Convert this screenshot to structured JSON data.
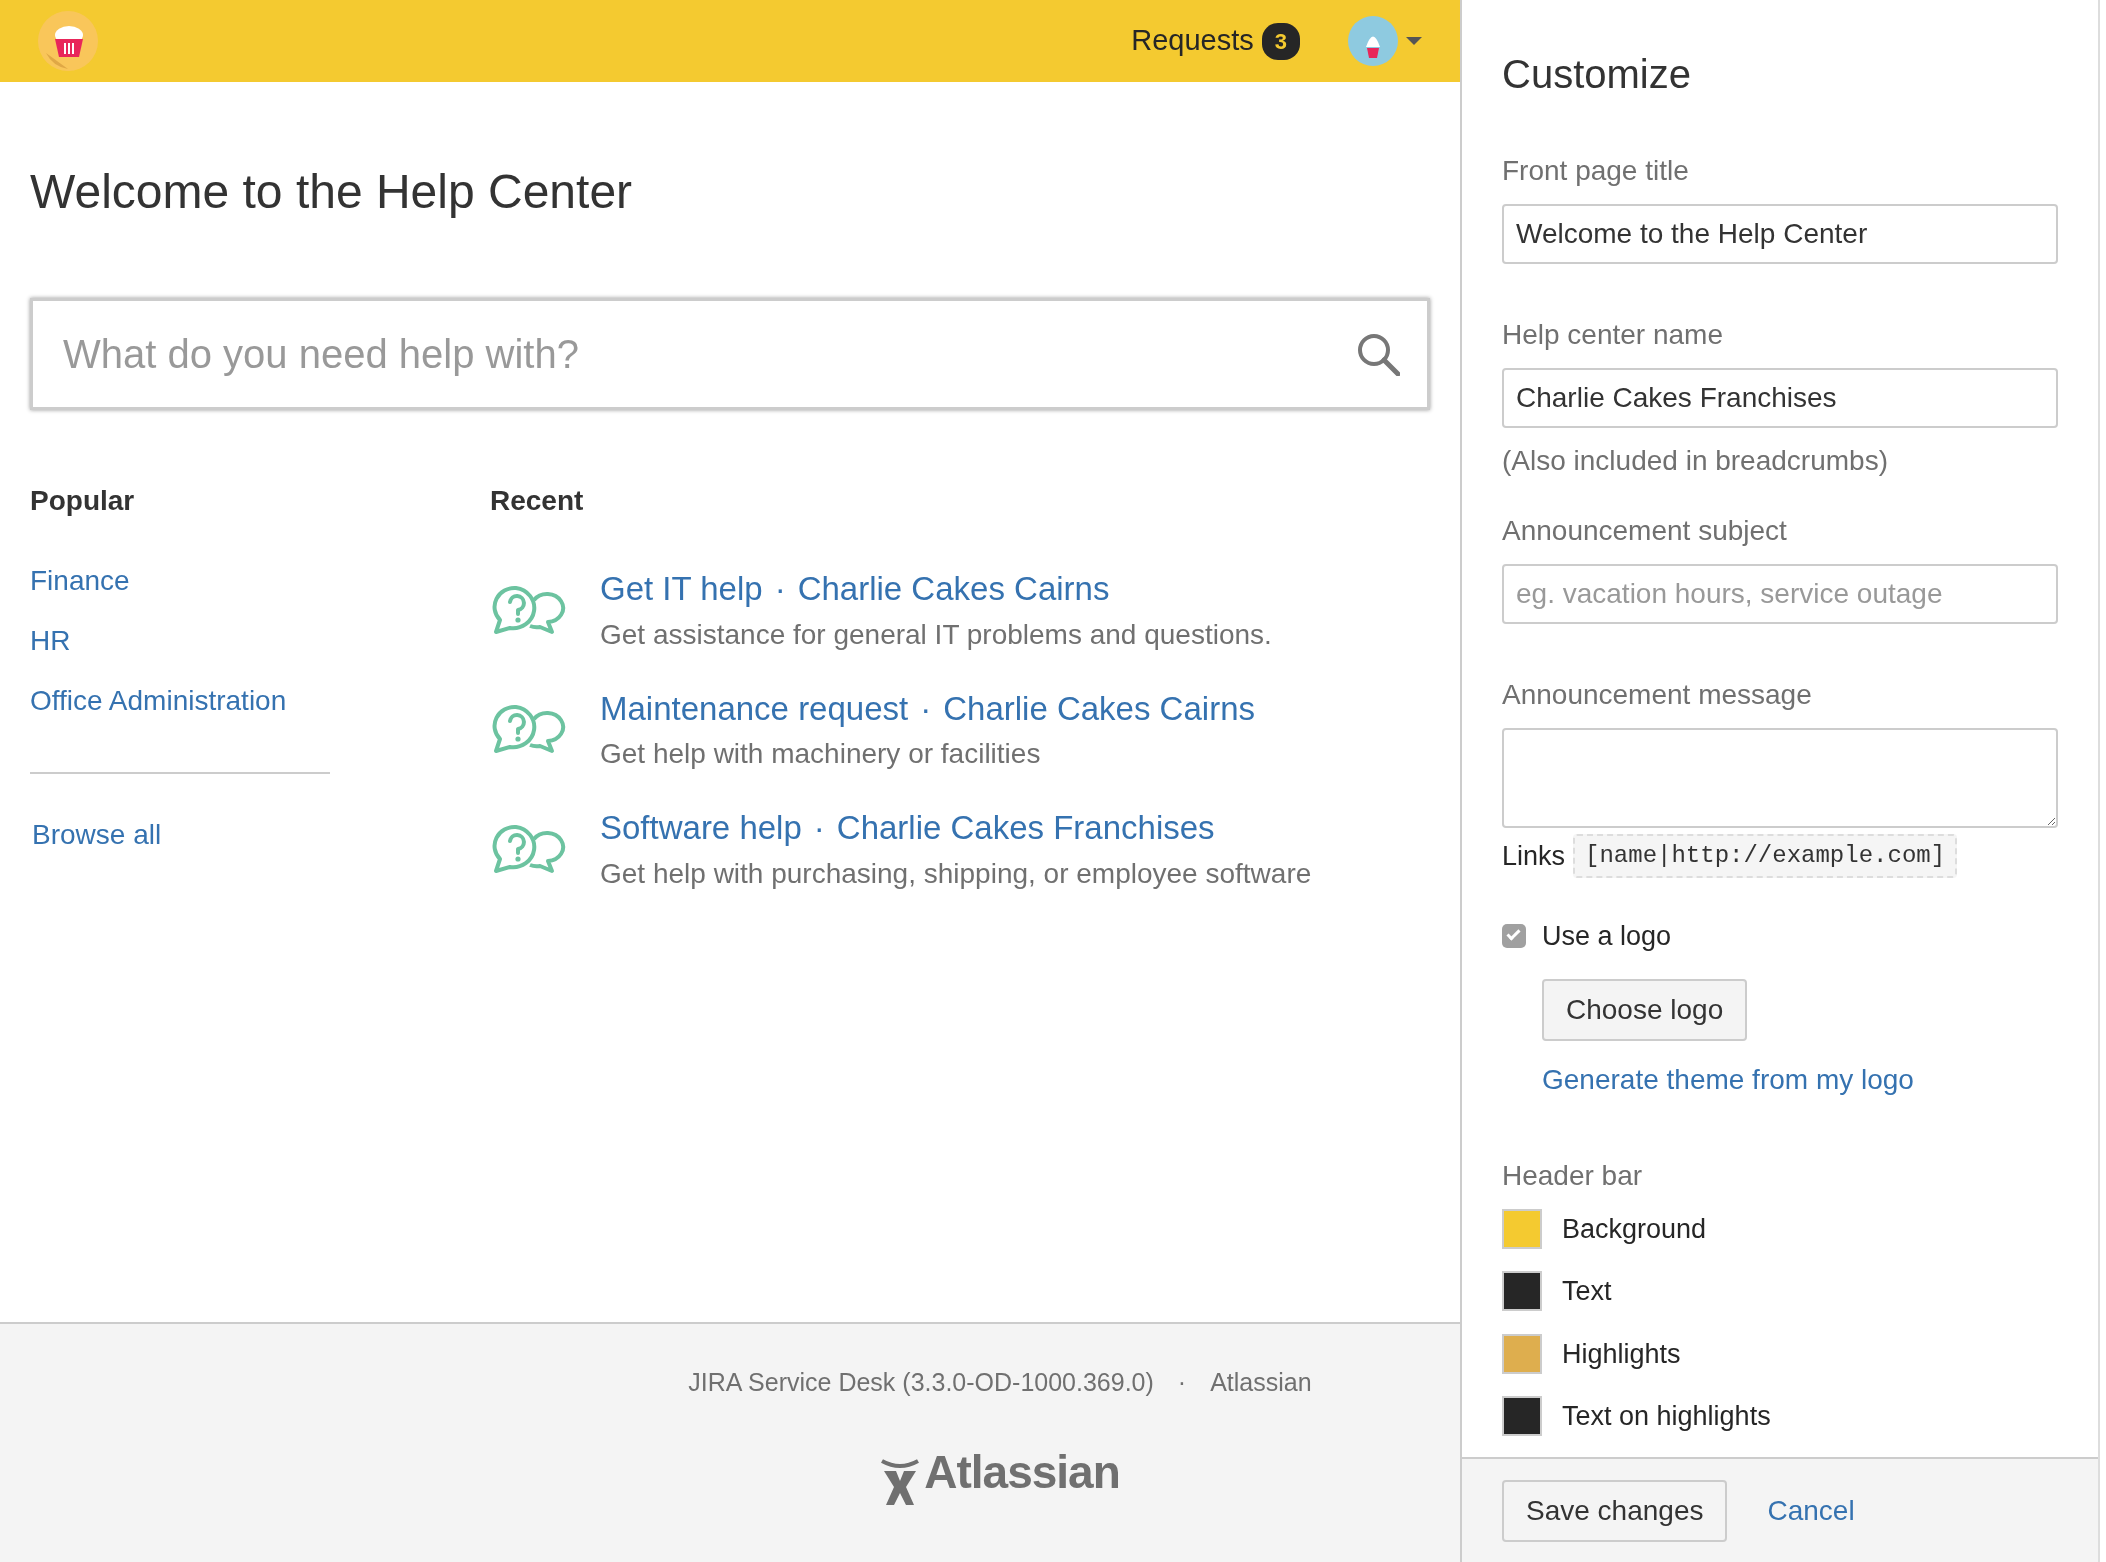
{
  "header": {
    "requests_label": "Requests",
    "requests_count": "3"
  },
  "main": {
    "title": "Welcome to the Help Center",
    "search_placeholder": "What do you need help with?"
  },
  "popular": {
    "heading": "Popular",
    "items": [
      "Finance",
      "HR",
      "Office Administration"
    ],
    "browse_all": "Browse all"
  },
  "recent": {
    "heading": "Recent",
    "items": [
      {
        "name": "Get IT help",
        "separator": "·",
        "project": "Charlie Cakes Cairns",
        "description": "Get assistance for general IT problems and questions."
      },
      {
        "name": "Maintenance request",
        "separator": "·",
        "project": "Charlie Cakes Cairns",
        "description": "Get help with machinery or facilities"
      },
      {
        "name": "Software help",
        "separator": "·",
        "project": "Charlie Cakes Franchises",
        "description": "Get help with purchasing, shipping, or employee software"
      }
    ]
  },
  "footer": {
    "version": "JIRA Service Desk (3.3.0-OD-1000.369.0)",
    "separator": "·",
    "company": "Atlassian",
    "logo_text": "Atlassian"
  },
  "customize": {
    "title": "Customize",
    "fields": [
      {
        "kind": "input",
        "label": "Front page title",
        "value": "Welcome to the Help Center"
      },
      {
        "kind": "input",
        "label": "Help center name",
        "value": "Charlie Cakes Franchises",
        "hint": "(Also included in breadcrumbs)"
      },
      {
        "kind": "input",
        "label": "Announcement subject",
        "placeholder": "eg. vacation hours, service outage"
      },
      {
        "kind": "textarea",
        "label": "Announcement message"
      }
    ],
    "links_label": "Links",
    "links_code": "[name|http://example.com]",
    "use_logo": {
      "label": "Use a logo",
      "checked": true
    },
    "choose_logo": "Choose logo",
    "generate_link": "Generate theme from my logo",
    "header_bar": {
      "heading": "Header bar",
      "colors": [
        {
          "label": "Background",
          "color": "#f4ca30"
        },
        {
          "label": "Text",
          "color": "#262626"
        },
        {
          "label": "Highlights",
          "color": "#deae4e"
        },
        {
          "label": "Text on highlights",
          "color": "#262626"
        }
      ]
    },
    "save": "Save changes",
    "cancel": "Cancel"
  }
}
